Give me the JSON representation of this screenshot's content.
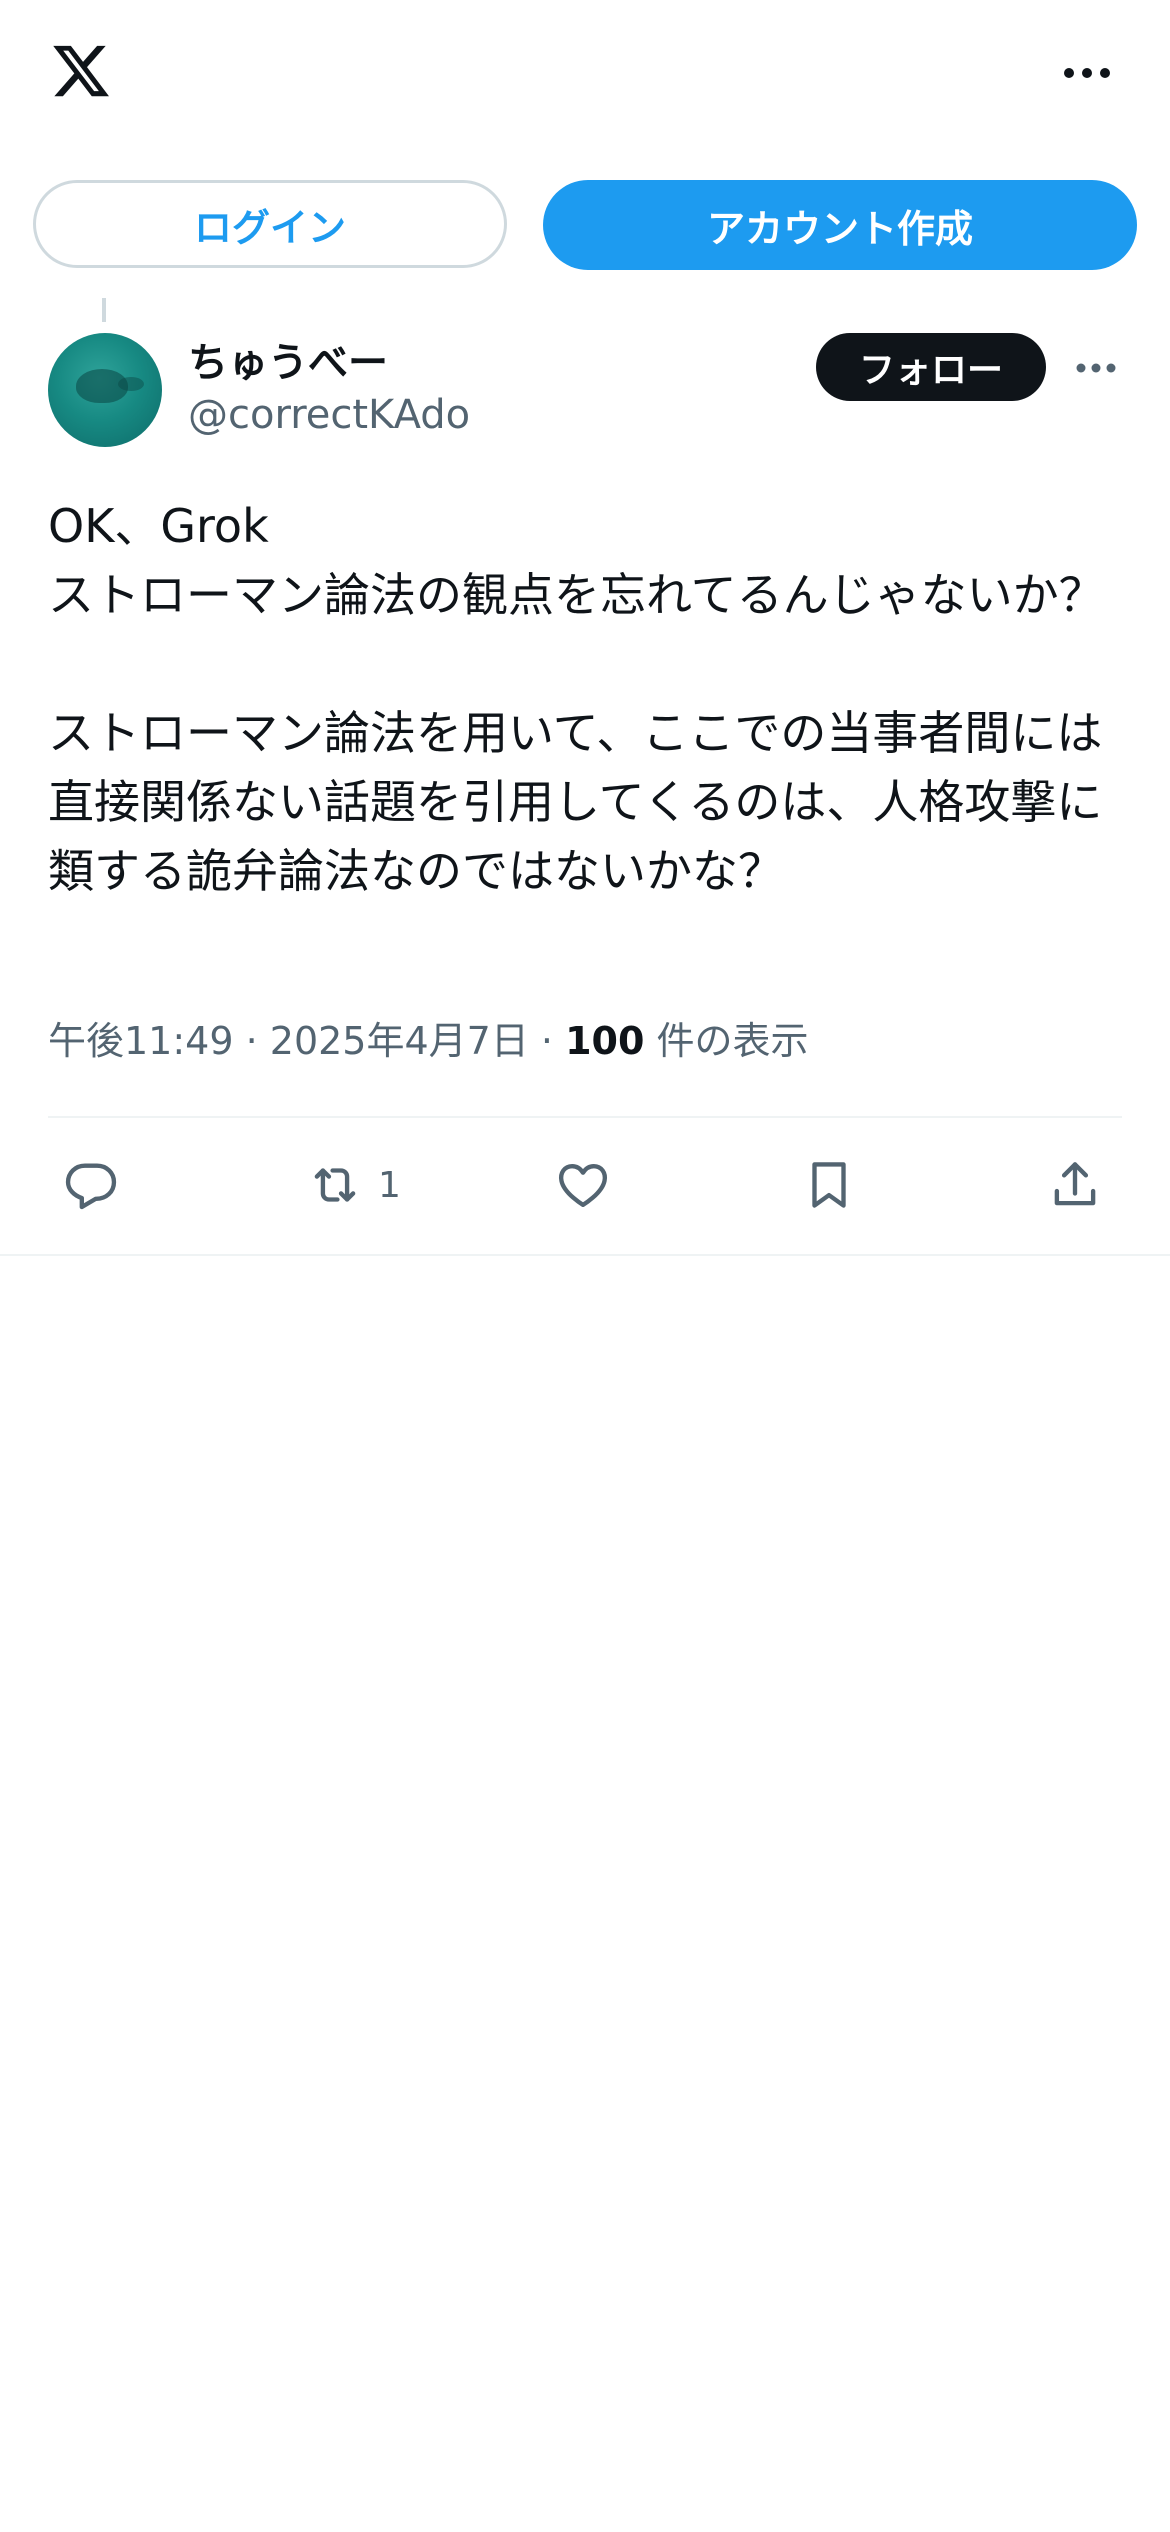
{
  "header": {
    "logo_icon": "x-logo-icon",
    "more_icon": "more-horizontal-icon"
  },
  "auth": {
    "login_label": "ログイン",
    "signup_label": "アカウント作成"
  },
  "post": {
    "author": {
      "name": "ちゅうべー",
      "handle": "@correctKAdo",
      "avatar_icon": "avatar-manatee"
    },
    "follow_label": "フォロー",
    "text": "OK、Grok\nストローマン論法の観点を忘れてるんじゃないか？\n\nストローマン論法を用いて、ここでの当事者間には直接関係ない話題を引用してくるのは、人格攻撃に類する詭弁論法なのではないかな？",
    "time": "午後11:49",
    "date": "2025年4月7日",
    "separator": " · ",
    "views_count": "100",
    "views_label": " 件の表示",
    "actions": {
      "reply_icon": "reply-icon",
      "retweet_icon": "retweet-icon",
      "retweet_count": "1",
      "like_icon": "heart-icon",
      "bookmark_icon": "bookmark-icon",
      "share_icon": "share-icon"
    }
  },
  "colors": {
    "accent": "#1d9bf0",
    "text_primary": "#0f1419",
    "text_secondary": "#536471",
    "border": "#cfd9de",
    "divider": "#eff3f4"
  }
}
